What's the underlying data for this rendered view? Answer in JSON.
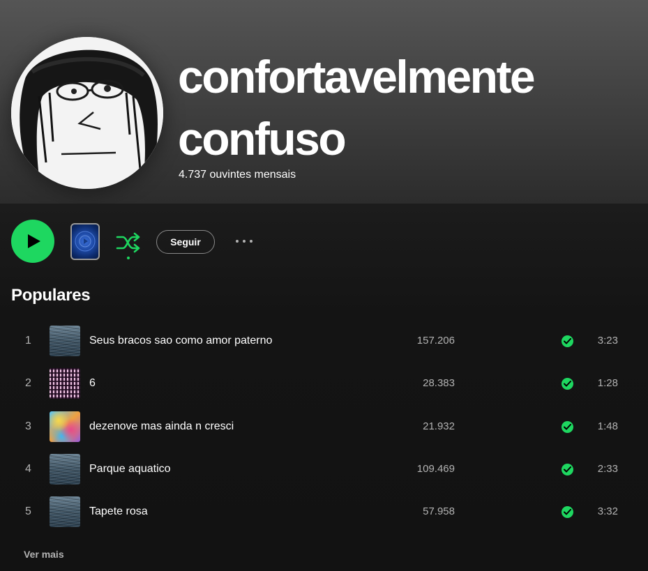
{
  "artist": {
    "name_line1": "confortavelmente",
    "name_line2": "confuso",
    "monthly_listeners": "4.737 ouvintes mensais"
  },
  "controls": {
    "follow_label": "Seguir"
  },
  "popular": {
    "section_title": "Populares",
    "tracks": [
      {
        "number": "1",
        "title": "Seus bracos sao como amor paterno",
        "plays": "157.206",
        "duration": "3:23",
        "saved": true,
        "cover": "ocean-water"
      },
      {
        "number": "2",
        "title": "6",
        "plays": "28.383",
        "duration": "1:28",
        "saved": true,
        "cover": "pink-pattern"
      },
      {
        "number": "3",
        "title": "dezenove mas ainda n cresci",
        "plays": "21.932",
        "duration": "1:48",
        "saved": true,
        "cover": "colorful-abstract"
      },
      {
        "number": "4",
        "title": "Parque aquatico",
        "plays": "109.469",
        "duration": "2:33",
        "saved": true,
        "cover": "ocean-water"
      },
      {
        "number": "5",
        "title": "Tapete rosa",
        "plays": "57.958",
        "duration": "3:32",
        "saved": true,
        "cover": "ocean-water"
      }
    ],
    "see_more_label": "Ver mais"
  },
  "colors": {
    "accent": "#1ed760",
    "background": "#121212",
    "header_top": "#555555",
    "muted_text": "#b3b3b3"
  }
}
